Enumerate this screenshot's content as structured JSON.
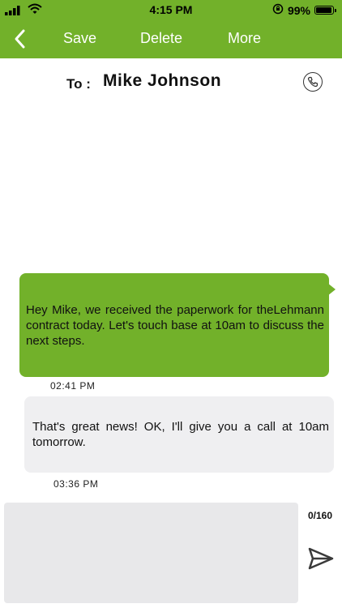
{
  "status_bar": {
    "time": "4:15 PM",
    "battery": "99%",
    "battery_level": 0.99,
    "icons": [
      "signal-icon",
      "wifi-icon",
      "orientation-lock-icon",
      "battery-icon"
    ]
  },
  "nav": {
    "back_icon": "chevron-left-icon",
    "save_label": "Save",
    "delete_label": "Delete",
    "more_label": "More"
  },
  "recipient": {
    "to_label": "To :",
    "name": "Mike Johnson",
    "call_icon": "phone-icon"
  },
  "messages": [
    {
      "direction": "outgoing",
      "text": "Hey Mike, we received the paperwork for theLehmann contract today. Let's touch base at 10am to discuss the next steps.",
      "time": "02:41 PM"
    },
    {
      "direction": "incoming",
      "text": "That's great news! OK, I'll give you a call at 10am tomorrow.",
      "time": "03:36 PM"
    }
  ],
  "composer": {
    "value": "",
    "counter": "0/160",
    "send_icon": "send-icon"
  },
  "colors": {
    "accent": "#72b12a",
    "incoming_bubble": "#efeff1",
    "composer_bg": "#e8e8ea"
  }
}
